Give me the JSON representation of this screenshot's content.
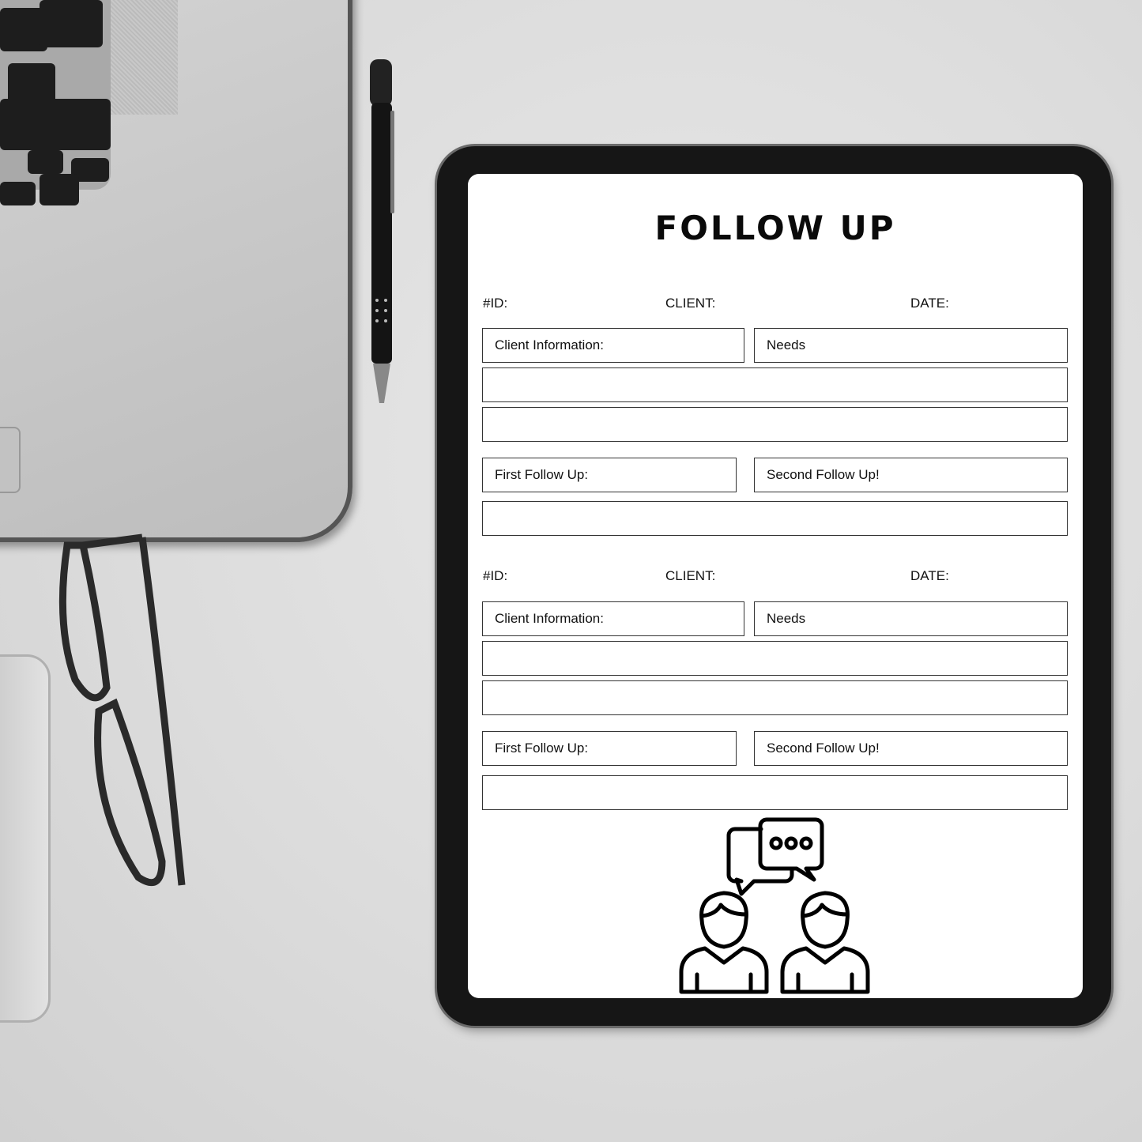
{
  "form": {
    "title": "FOLLOW UP",
    "sections": [
      {
        "id_label": "#ID:",
        "client_label": "CLIENT:",
        "date_label": "DATE:",
        "client_info": "Client Information:",
        "needs": "Needs",
        "first_follow_up": "First Follow Up:",
        "second_follow_up": "Second Follow Up!"
      },
      {
        "id_label": "#ID:",
        "client_label": "CLIENT:",
        "date_label": "DATE:",
        "client_info": "Client Information:",
        "needs": "Needs",
        "first_follow_up": "First Follow Up:",
        "second_follow_up": "Second Follow Up!"
      }
    ],
    "illustration_icon": "two-people-chat-icon"
  }
}
